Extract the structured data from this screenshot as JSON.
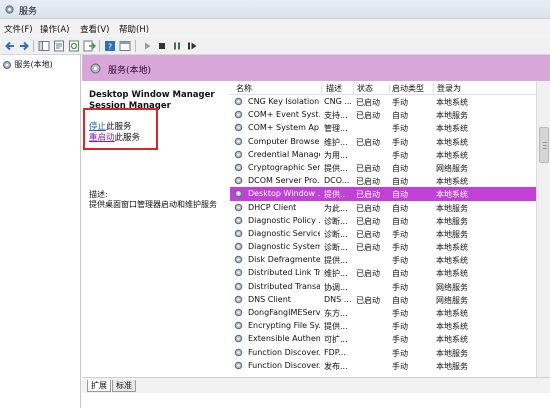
{
  "window": {
    "title": "服务"
  },
  "menu": [
    "文件(F)",
    "操作(A)",
    "查看(V)",
    "帮助(H)"
  ],
  "toolbar": {
    "icons": [
      "back-icon",
      "forward-icon",
      "console-tree-icon",
      "properties-icon",
      "refresh-icon",
      "export-icon",
      "help-icon",
      "mmc-icon",
      "play-icon",
      "stop-icon",
      "pause-icon",
      "restart-icon"
    ]
  },
  "tree": {
    "root": "服务(本地)"
  },
  "header": {
    "title": "服务(本地)"
  },
  "selected_service": {
    "name": "Desktop Window Manager Session Manager",
    "stop_link": "停止",
    "stop_suffix": "此服务",
    "restart_link": "重启动",
    "restart_suffix": "此服务",
    "desc_label": "描述:",
    "desc_text": "提供桌面窗口管理器启动和维护服务"
  },
  "columns": {
    "name": "名称",
    "desc": "描述",
    "status": "状态",
    "startup": "启动类型",
    "logon": "登录为"
  },
  "services": [
    {
      "name": "CNG Key Isolation",
      "desc": "CNG ...",
      "status": "已启动",
      "startup": "手动",
      "logon": "本地系统"
    },
    {
      "name": "COM+ Event Syst...",
      "desc": "支持...",
      "status": "已启动",
      "startup": "自动",
      "logon": "本地服务"
    },
    {
      "name": "COM+ System Ap...",
      "desc": "管理...",
      "status": "",
      "startup": "手动",
      "logon": "本地系统"
    },
    {
      "name": "Computer Browser",
      "desc": "维护...",
      "status": "已启动",
      "startup": "手动",
      "logon": "本地系统"
    },
    {
      "name": "Credential Manager",
      "desc": "为用...",
      "status": "",
      "startup": "手动",
      "logon": "本地系统"
    },
    {
      "name": "Cryptographic Ser...",
      "desc": "提供...",
      "status": "已启动",
      "startup": "自动",
      "logon": "网络服务"
    },
    {
      "name": "DCOM Server Pro...",
      "desc": "DCO...",
      "status": "已启动",
      "startup": "自动",
      "logon": "本地系统"
    },
    {
      "name": "Desktop Window ...",
      "desc": "提供...",
      "status": "已启动",
      "startup": "自动",
      "logon": "本地系统"
    },
    {
      "name": "DHCP Client",
      "desc": "为此...",
      "status": "已启动",
      "startup": "自动",
      "logon": "本地服务"
    },
    {
      "name": "Diagnostic Policy ...",
      "desc": "诊断...",
      "status": "已启动",
      "startup": "自动",
      "logon": "本地服务"
    },
    {
      "name": "Diagnostic Service...",
      "desc": "诊断...",
      "status": "已启动",
      "startup": "手动",
      "logon": "本地服务"
    },
    {
      "name": "Diagnostic System...",
      "desc": "诊断...",
      "status": "已启动",
      "startup": "手动",
      "logon": "本地系统"
    },
    {
      "name": "Disk Defragmenter",
      "desc": "提供...",
      "status": "",
      "startup": "手动",
      "logon": "本地系统"
    },
    {
      "name": "Distributed Link Tr...",
      "desc": "维护...",
      "status": "已启动",
      "startup": "自动",
      "logon": "本地系统"
    },
    {
      "name": "Distributed Transa...",
      "desc": "协调...",
      "status": "",
      "startup": "手动",
      "logon": "网络服务"
    },
    {
      "name": "DNS Client",
      "desc": "DNS ...",
      "status": "已启动",
      "startup": "自动",
      "logon": "网络服务"
    },
    {
      "name": "DongFangIMEServ...",
      "desc": "东方...",
      "status": "",
      "startup": "手动",
      "logon": "本地系统"
    },
    {
      "name": "Encrypting File Sy...",
      "desc": "提供...",
      "status": "",
      "startup": "手动",
      "logon": "本地系统"
    },
    {
      "name": "Extensible Authen...",
      "desc": "可扩...",
      "status": "",
      "startup": "手动",
      "logon": "本地系统"
    },
    {
      "name": "Function Discover...",
      "desc": "FDP...",
      "status": "",
      "startup": "手动",
      "logon": "本地服务"
    },
    {
      "name": "Function Discover...",
      "desc": "发布...",
      "status": "",
      "startup": "手动",
      "logon": "本地服务"
    }
  ],
  "selected_index": 7,
  "bottom_tabs": [
    "扩展",
    "标准"
  ],
  "colors": {
    "header_band": "#d9a6d9",
    "selection": "#c040d8",
    "highlight_box": "#d8262e"
  }
}
